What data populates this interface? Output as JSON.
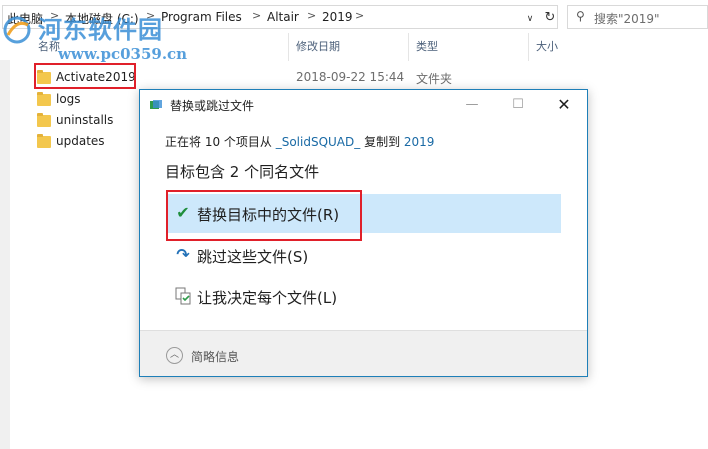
{
  "address_bar": {
    "crumbs": [
      "此电脑",
      "本地磁盘 (C:)",
      "Program Files",
      "Altair",
      "2019"
    ],
    "separator": ">",
    "dropdown": "∨",
    "refresh": "↻"
  },
  "search": {
    "placeholder": "搜索\"2019\"",
    "icon": "⚲"
  },
  "watermark": {
    "title": "河东软件园",
    "url": "www.pc0359.cn"
  },
  "columns": {
    "name": "名称",
    "modified": "修改日期",
    "type": "类型",
    "size": "大小"
  },
  "files": [
    {
      "name": "Activate2019",
      "modified": "2018-09-22 15:44",
      "type": "文件夹"
    },
    {
      "name": "logs",
      "modified": "",
      "type": ""
    },
    {
      "name": "uninstalls",
      "modified": "",
      "type": ""
    },
    {
      "name": "updates",
      "modified": "",
      "type": ""
    }
  ],
  "dialog": {
    "title": "替换或跳过文件",
    "minimize": "—",
    "maximize": "☐",
    "close": "✕",
    "line_prefix": "正在将 10 个项目从 ",
    "source": "_SolidSQUAD_",
    "line_middle": " 复制到 ",
    "dest": "2019",
    "heading": "目标包含 2 个同名文件",
    "options": [
      {
        "icon": "check-icon",
        "glyph": "✔",
        "label": "替换目标中的文件(R)"
      },
      {
        "icon": "skip-arrow-icon",
        "glyph": "↷",
        "label": "跳过这些文件(S)"
      },
      {
        "icon": "compare-files-icon",
        "glyph": "⧉",
        "label": "让我决定每个文件(L)"
      }
    ],
    "footer": {
      "chevron": "︿",
      "label": "简略信息"
    }
  },
  "colors": {
    "accent": "#1e7fb8",
    "highlight": "#cde8fb",
    "annotation_red": "#e0202a",
    "watermark": "#3a8fd6"
  }
}
